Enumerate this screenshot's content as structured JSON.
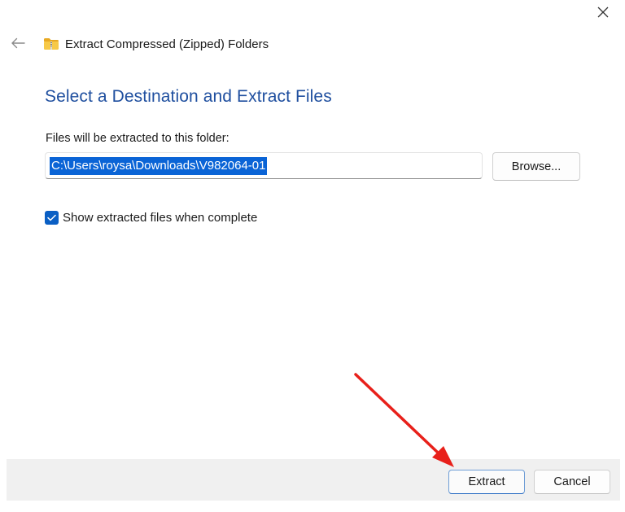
{
  "window": {
    "close_icon": "close-icon",
    "back_icon": "back-arrow-icon"
  },
  "header": {
    "icon": "zipped-folder-icon",
    "title": "Extract Compressed (Zipped) Folders"
  },
  "main": {
    "heading": "Select a Destination and Extract Files",
    "path_label": "Files will be extracted to this folder:",
    "path_value": "C:\\Users\\roysa\\Downloads\\V982064-01",
    "browse_label": "Browse...",
    "show_files_checkbox": {
      "label": "Show extracted files when complete",
      "checked": true
    }
  },
  "footer": {
    "extract_label": "Extract",
    "cancel_label": "Cancel"
  },
  "annotation": {
    "arrow_color": "#e8201a",
    "target": "extract-button"
  },
  "colors": {
    "heading": "#1f4f9f",
    "selection": "#0a64d6",
    "checkbox": "#0a5fc4",
    "footer_bg": "#f0f0f0"
  }
}
